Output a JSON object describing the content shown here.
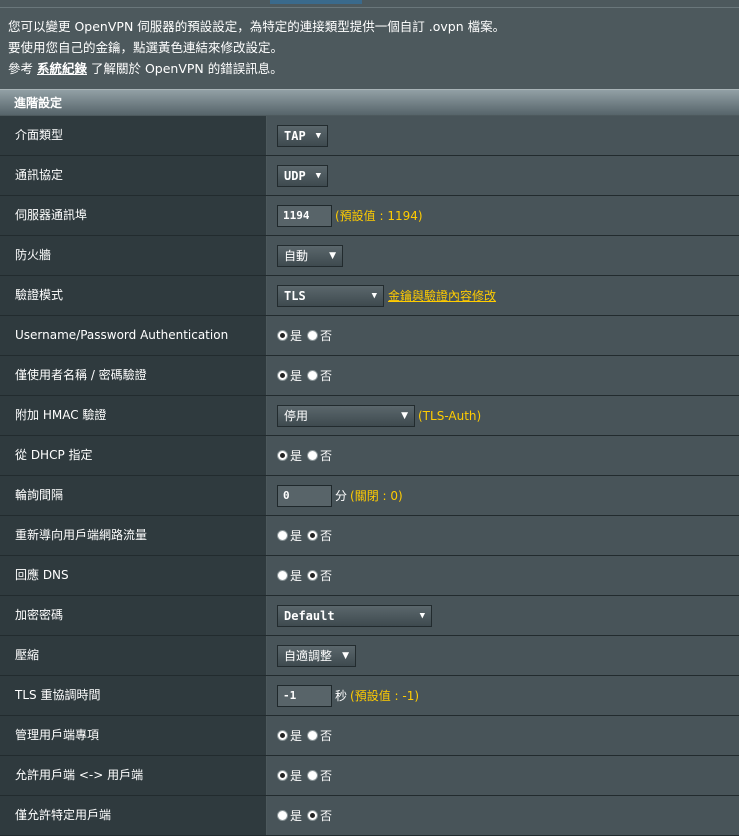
{
  "intro": {
    "line1": "您可以變更 OpenVPN 伺服器的預設設定，為特定的連接類型提供一個自訂 .ovpn 檔案。",
    "line2": "要使用您自己的金鑰，點選黃色連結來修改設定。",
    "line3_prefix": "參考 ",
    "line3_link": "系統紀錄",
    "line3_suffix": " 了解關於 OpenVPN 的錯誤訊息。"
  },
  "panel_title": "進階設定",
  "radio_yes": "是",
  "radio_no": "否",
  "rows": {
    "interface_type": {
      "label": "介面類型",
      "value": "TAP"
    },
    "protocol": {
      "label": "通訊協定",
      "value": "UDP"
    },
    "server_port": {
      "label": "伺服器通訊埠",
      "value": "1194",
      "hint": "(預設值 : 1194)"
    },
    "firewall": {
      "label": "防火牆",
      "value": "自動"
    },
    "auth_mode": {
      "label": "驗證模式",
      "value": "TLS",
      "link": "金鑰與驗證內容修改"
    },
    "userpass_auth": {
      "label": "Username/Password Authentication",
      "selected": "yes"
    },
    "userpass_only": {
      "label": "僅使用者名稱 / 密碼驗證",
      "selected": "yes"
    },
    "hmac": {
      "label": "附加 HMAC 驗證",
      "value": "停用",
      "hint": "(TLS-Auth)"
    },
    "dhcp": {
      "label": "從 DHCP 指定",
      "selected": "yes"
    },
    "poll_interval": {
      "label": "輪詢間隔",
      "value": "0",
      "unit": "分",
      "hint": "(關閉 : 0)"
    },
    "redirect_traffic": {
      "label": "重新導向用戶端網路流量",
      "selected": "no"
    },
    "respond_dns": {
      "label": "回應 DNS",
      "selected": "no"
    },
    "cipher": {
      "label": "加密密碼",
      "value": "Default"
    },
    "compression": {
      "label": "壓縮",
      "value": "自適調整"
    },
    "tls_reneg": {
      "label": "TLS 重協調時間",
      "value": "-1",
      "unit": "秒",
      "hint": "(預設值 : -1)"
    },
    "manage_client": {
      "label": "管理用戶端專項",
      "selected": "yes"
    },
    "client_to_client": {
      "label": "允許用戶端 <-> 用戶端",
      "selected": "yes"
    },
    "specific_clients": {
      "label": "僅允許特定用戶端",
      "selected": "no"
    }
  }
}
